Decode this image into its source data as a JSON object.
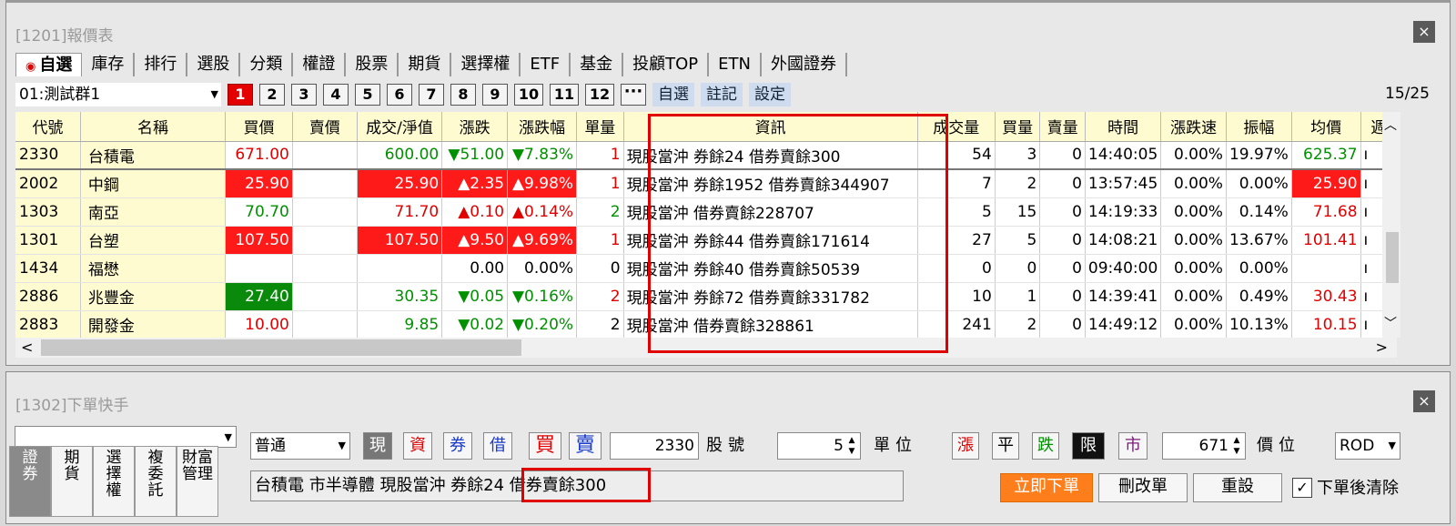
{
  "quote_window": {
    "title": "[1201]報價表",
    "close": "×",
    "tabs": [
      "自選",
      "庫存",
      "排行",
      "選股",
      "分類",
      "權證",
      "股票",
      "期貨",
      "選擇權",
      "ETF",
      "基金",
      "投顧TOP",
      "ETN",
      "外國證券"
    ],
    "active_tab_dot": "◉",
    "group_select": "01:測試群1",
    "group_numbers": [
      "1",
      "2",
      "3",
      "4",
      "5",
      "6",
      "7",
      "8",
      "9",
      "10",
      "11",
      "12"
    ],
    "more_label": "···",
    "links": [
      "自選",
      "註記",
      "設定"
    ],
    "page_count": "15/25",
    "columns": [
      "代號",
      "名稱",
      "買價",
      "賣價",
      "成交/淨值",
      "漲跌",
      "漲跌幅",
      "單量",
      "資訊",
      "成交量",
      "買量",
      "賣量",
      "時間",
      "漲跌速",
      "振幅",
      "均價",
      "週"
    ],
    "rows": [
      {
        "code": "2330",
        "name": "台積電",
        "bid": "671.00",
        "ask": "",
        "last": "600.00",
        "chg": "▼51.00",
        "pct": "▼7.83%",
        "vol": "1",
        "info": "現股當沖 券餘24 借券賣餘300",
        "total": "54",
        "bidq": "3",
        "askq": "0",
        "time": "14:40:05",
        "speed": "0.00%",
        "amp": "19.97%",
        "avg": "625.37",
        "wk": "ı"
      },
      {
        "code": "2002",
        "name": "中鋼",
        "bid": "25.90",
        "ask": "",
        "last": "25.90",
        "chg": "▲2.35",
        "pct": "▲9.98%",
        "vol": "1",
        "info": "現股當沖 券餘1952 借券賣餘344907",
        "total": "7",
        "bidq": "2",
        "askq": "0",
        "time": "13:57:45",
        "speed": "0.00%",
        "amp": "0.00%",
        "avg": "25.90",
        "wk": "ı"
      },
      {
        "code": "1303",
        "name": "南亞",
        "bid": "70.70",
        "ask": "",
        "last": "71.70",
        "chg": "▲0.10",
        "pct": "▲0.14%",
        "vol": "2",
        "info": "現股當沖 借券賣餘228707",
        "total": "5",
        "bidq": "15",
        "askq": "0",
        "time": "14:19:33",
        "speed": "0.00%",
        "amp": "0.14%",
        "avg": "71.68",
        "wk": "ı"
      },
      {
        "code": "1301",
        "name": "台塑",
        "bid": "107.50",
        "ask": "",
        "last": "107.50",
        "chg": "▲9.50",
        "pct": "▲9.69%",
        "vol": "1",
        "info": "現股當沖 券餘44 借券賣餘171614",
        "total": "27",
        "bidq": "5",
        "askq": "0",
        "time": "14:08:21",
        "speed": "0.00%",
        "amp": "13.67%",
        "avg": "101.41",
        "wk": "ı"
      },
      {
        "code": "1434",
        "name": "福懋",
        "bid": "",
        "ask": "",
        "last": "",
        "chg": "0.00",
        "pct": "0.00%",
        "vol": "0",
        "info": "現股當沖 券餘40 借券賣餘50539",
        "total": "0",
        "bidq": "0",
        "askq": "0",
        "time": "09:40:00",
        "speed": "0.00%",
        "amp": "0.00%",
        "avg": "",
        "wk": "ı"
      },
      {
        "code": "2886",
        "name": "兆豐金",
        "bid": "27.40",
        "ask": "",
        "last": "30.35",
        "chg": "▼0.05",
        "pct": "▼0.16%",
        "vol": "2",
        "info": "現股當沖 券餘72 借券賣餘331782",
        "total": "10",
        "bidq": "1",
        "askq": "0",
        "time": "14:39:41",
        "speed": "0.00%",
        "amp": "0.49%",
        "avg": "30.43",
        "wk": "ı"
      },
      {
        "code": "2883",
        "name": "開發金",
        "bid": "10.00",
        "ask": "",
        "last": "9.85",
        "chg": "▼0.02",
        "pct": "▼0.20%",
        "vol": "2",
        "info": "現股當沖 借券賣餘328861",
        "total": "241",
        "bidq": "2",
        "askq": "0",
        "time": "14:49:12",
        "speed": "0.00%",
        "amp": "10.13%",
        "avg": "10.15",
        "wk": "ı"
      }
    ],
    "scroll_left": "<",
    "scroll_right": ">",
    "scroll_up": "︿",
    "scroll_down": "﹀"
  },
  "order_window": {
    "title": "[1302]下單快手",
    "close": "×",
    "account_select": "",
    "order_type": "普通",
    "btn_cash": "現",
    "btn_margin": "資",
    "btn_short": "券",
    "btn_borrow": "借",
    "btn_buy": "買",
    "btn_sell": "賣",
    "stock_no": "2330",
    "stock_no_label": "股號",
    "qty": "5",
    "qty_label": "單位",
    "btn_up": "漲",
    "btn_flat": "平",
    "btn_down": "跌",
    "btn_limit": "限",
    "btn_market": "市",
    "price": "671",
    "price_label": "價位",
    "tif": "ROD",
    "info_text": "台積電 市半導體 現股當沖 券餘24 借券賣餘300",
    "submit": "立即下單",
    "modify": "刪改單",
    "reset": "重設",
    "clear_after": "下單後清除",
    "checkbox_mark": "✓",
    "side_tabs": [
      [
        "證",
        "券"
      ],
      [
        "期",
        "貨"
      ],
      [
        "選",
        "擇",
        "權"
      ],
      [
        "複",
        "委",
        "託"
      ],
      [
        "財富",
        "管理"
      ]
    ]
  },
  "colors": {
    "up": "#e00000",
    "down": "#009000",
    "highlight": "#e00000",
    "submit": "#ff7e1c"
  }
}
